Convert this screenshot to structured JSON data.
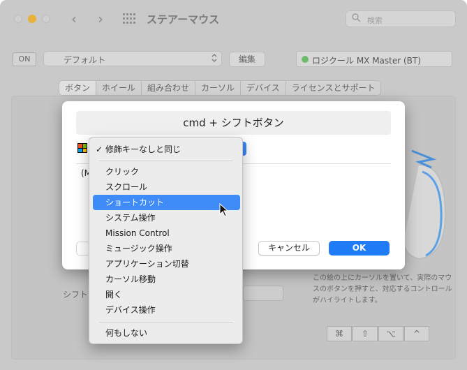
{
  "window": {
    "title": "ステアーマウス",
    "search_placeholder": "検索",
    "back_glyph": "‹",
    "forward_glyph": "›"
  },
  "toolbar": {
    "on_label": "ON",
    "preset_value": "デフォルト",
    "edit_label": "編集",
    "device_name": "ロジクール MX Master (BT)",
    "device_status_color": "#6dbb6d"
  },
  "tabs": [
    {
      "label": "ボタン",
      "active": true
    },
    {
      "label": "ホイール"
    },
    {
      "label": "組み合わせ"
    },
    {
      "label": "カーソル"
    },
    {
      "label": "デバイス"
    },
    {
      "label": "ライセンスとサポート"
    }
  ],
  "background": {
    "shift_label": "シフト",
    "help_text": "この絵の上にカーソルを置いて、実際のマウスのボタンを押すと、対応するコントロールがハイライトします。",
    "modifier_keys": [
      "⌘",
      "⇧",
      "⌥",
      "^"
    ]
  },
  "modal": {
    "title": "cmd + シフトボタン",
    "partial_text": "(M",
    "cancel_label": "キャンセル",
    "ok_label": "OK",
    "accent_color": "#1f7cf6"
  },
  "menu": {
    "checked_item": "修飾キーなしと同じ",
    "check_glyph": "✓",
    "items": [
      "クリック",
      "スクロール",
      "ショートカット",
      "システム操作",
      "Mission Control",
      "ミュージック操作",
      "アプリケーション切替",
      "カーソル移動",
      "開く",
      "デバイス操作"
    ],
    "highlighted_item": "ショートカット",
    "last_item": "何もしない"
  },
  "icons": {
    "search": "search-icon",
    "stepper": "chevron-updown-icon",
    "grid": "grid-icon",
    "windows": "windows-logo-icon"
  }
}
